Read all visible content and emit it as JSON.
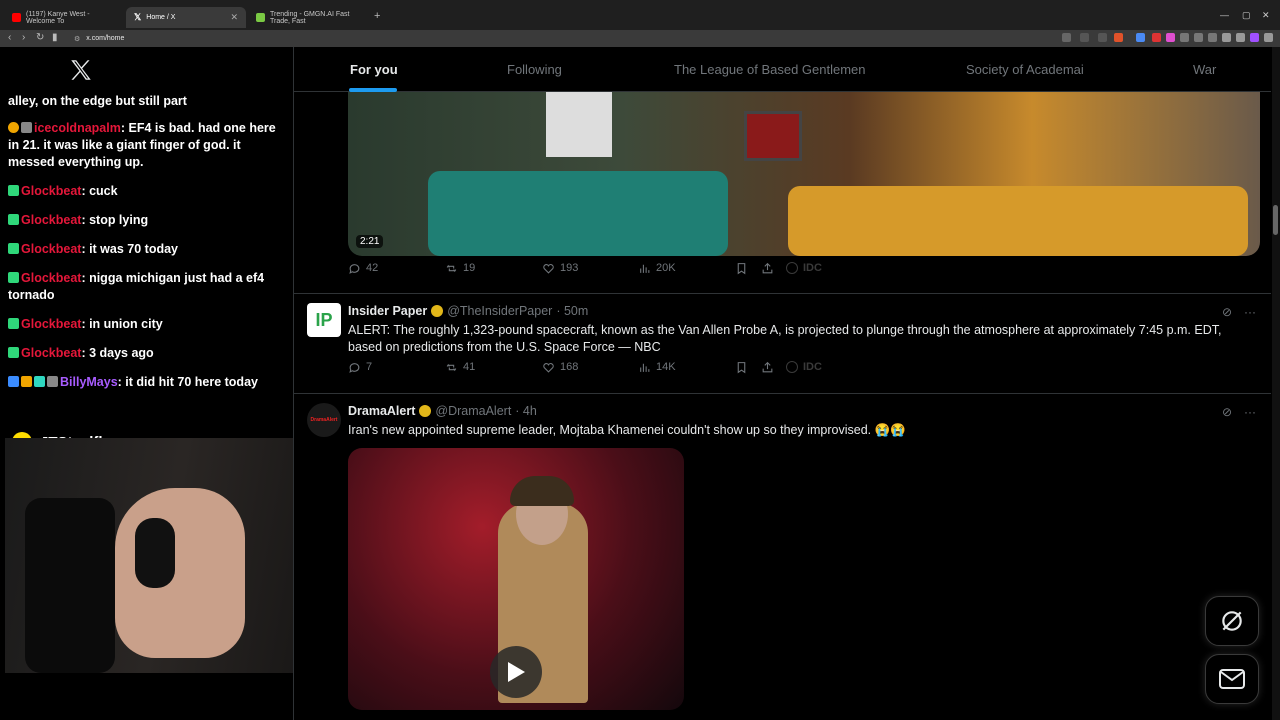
{
  "browser": {
    "tabs": [
      {
        "title": "(1197) Kanye West - Welcome To",
        "favicon_color": "#ff0000"
      },
      {
        "title": "Home / X",
        "favicon_color": "#ffffff"
      },
      {
        "title": "Trending - GMGN.AI Fast Trade, Fast",
        "favicon_color": "#7ac943"
      }
    ],
    "url": "x.com/home"
  },
  "overlay": {
    "chat": [
      {
        "user": "",
        "text": "alley, on the edge but still part"
      },
      {
        "user": "icecoldnapalm",
        "text": ": EF4 is bad. had one here in 21. it was like a giant finger of god. it messed everything up.",
        "color": "#e5173a"
      },
      {
        "user": "Glockbeat",
        "text": ": cuck",
        "color": "#e5173a"
      },
      {
        "user": "Glockbeat",
        "text": ": stop lying",
        "color": "#e5173a"
      },
      {
        "user": "Glockbeat",
        "text": ": it was 70 today",
        "color": "#e5173a"
      },
      {
        "user": "Glockbeat",
        "text": ": nigga michigan just had a ef4 tornado",
        "color": "#e5173a"
      },
      {
        "user": "Glockbeat",
        "text": ": in union city",
        "color": "#e5173a"
      },
      {
        "user": "Glockbeat",
        "text": ": 3 days ago",
        "color": "#e5173a"
      },
      {
        "user": "BillyMays",
        "text": ": it did hit 70 here today",
        "color": "#a85cff"
      }
    ],
    "snapchat_handle": "JTSteelflex"
  },
  "feed": {
    "tabs": [
      "For you",
      "Following",
      "The League of Based Gentlemen",
      "Society of Academai",
      "War"
    ],
    "active_tab": "For you",
    "accent": "#1d9bf0"
  },
  "posts": [
    {
      "video_duration": "2:21",
      "stats": {
        "replies": "42",
        "reposts": "19",
        "likes": "193",
        "views": "20K",
        "extra": "IDC"
      }
    },
    {
      "name": "Insider Paper",
      "handle": "@TheInsiderPaper",
      "time": "· 50m",
      "text": "ALERT: The roughly 1,323-pound spacecraft, known as the Van Allen Probe A, is projected to plunge through the atmosphere at approximately 7:45 p.m. EDT, based on predictions from the U.S. Space Force — NBC",
      "stats": {
        "replies": "7",
        "reposts": "41",
        "likes": "168",
        "views": "14K",
        "extra": "IDC"
      },
      "avatar_label": "IP"
    },
    {
      "name": "DramaAlert",
      "handle": "@DramaAlert",
      "time": "· 4h",
      "text": "Iran's new appointed supreme leader, Mojtaba Khamenei couldn't show up so they improvised. 😭😭",
      "avatar_label": "DramaAlert"
    }
  ]
}
